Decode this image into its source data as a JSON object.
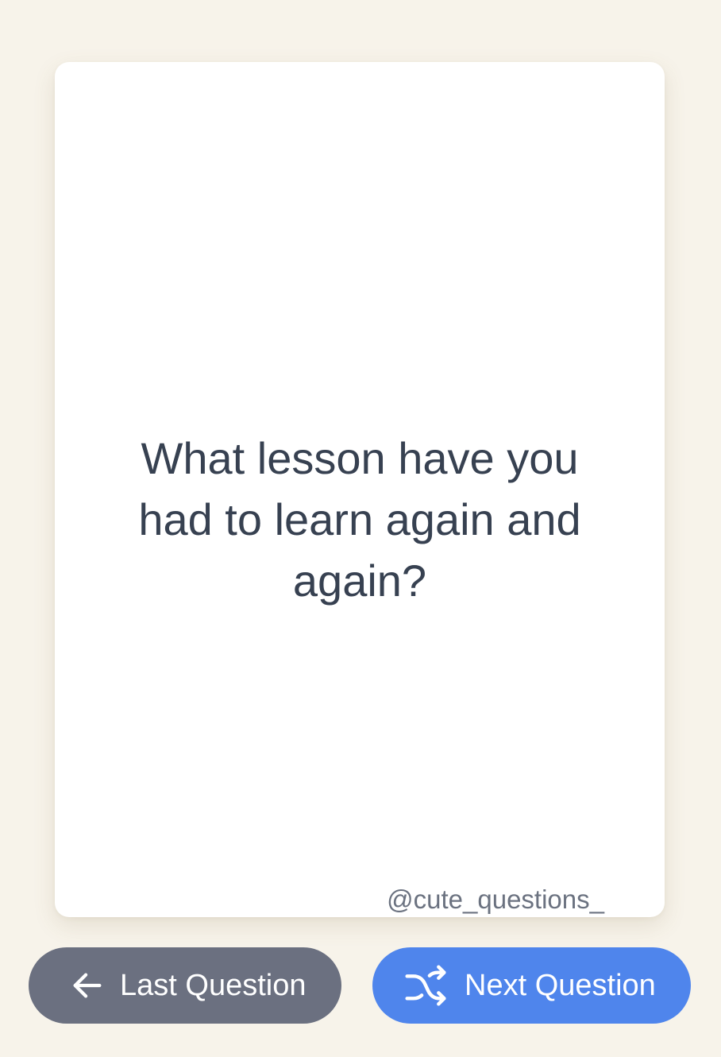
{
  "card": {
    "question": "What lesson have you had to learn again and again?",
    "handle": "@cute_questions_"
  },
  "buttons": {
    "last": {
      "label": "Last Question",
      "icon": "arrow-left-icon"
    },
    "next": {
      "label": "Next Question",
      "icon": "shuffle-icon"
    }
  },
  "colors": {
    "background": "#f7f3ea",
    "card": "#ffffff",
    "question_text": "#374151",
    "handle_text": "#6b7280",
    "last_button": "#6b7080",
    "next_button": "#4f85ec"
  }
}
